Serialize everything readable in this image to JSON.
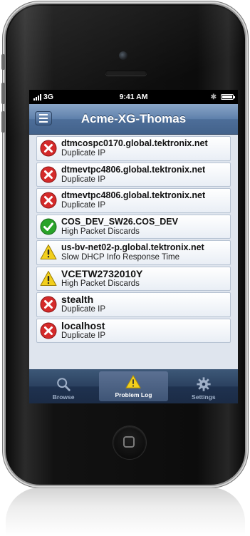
{
  "status_bar": {
    "carrier": "3G",
    "time": "9:41 AM"
  },
  "nav": {
    "title": "Acme-XG-Thomas"
  },
  "problems": [
    {
      "host": "dtmcospc0170.global.tektronix.net",
      "issue": "Duplicate IP",
      "severity": "error"
    },
    {
      "host": "dtmevtpc4806.global.tektronix.net",
      "issue": "Duplicate IP",
      "severity": "error"
    },
    {
      "host": "dtmevtpc4806.global.tektronix.net",
      "issue": "Duplicate IP",
      "severity": "error"
    },
    {
      "host": "COS_DEV_SW26.COS_DEV",
      "issue": "High Packet Discards",
      "severity": "ok"
    },
    {
      "host": "us-bv-net02-p.global.tektronix.net",
      "issue": "Slow DHCP Info Response Time",
      "severity": "warning"
    },
    {
      "host": "VCETW2732010Y",
      "issue": "High Packet Discards",
      "severity": "warning"
    },
    {
      "host": "stealth",
      "issue": "Duplicate IP",
      "severity": "error"
    },
    {
      "host": "localhost",
      "issue": "Duplicate IP",
      "severity": "error"
    }
  ],
  "tabs": {
    "browse": "Browse",
    "problem_log": "Problem Log",
    "settings": "Settings"
  },
  "colors": {
    "error": "#d42a2a",
    "ok": "#29a329",
    "warning": "#f2cf1d",
    "nav": "#4d6e99"
  }
}
